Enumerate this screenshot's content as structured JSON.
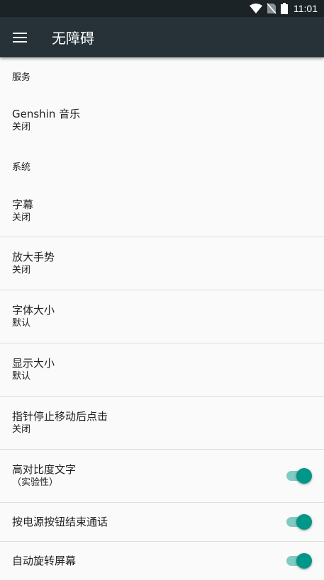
{
  "status_bar": {
    "time": "11:01",
    "icons": [
      "wifi-icon",
      "no-sim-icon",
      "battery-icon"
    ]
  },
  "toolbar": {
    "title": "无障碍",
    "menu_icon": "hamburger-menu-icon"
  },
  "sections": {
    "services_header": "服务",
    "system_header": "系统"
  },
  "items": {
    "genshin": {
      "title": "Genshin 音乐",
      "summary": "关闭"
    },
    "captions": {
      "title": "字幕",
      "summary": "关闭"
    },
    "magnification": {
      "title": "放大手势",
      "summary": "关闭"
    },
    "font_size": {
      "title": "字体大小",
      "summary": "默认"
    },
    "display_size": {
      "title": "显示大小",
      "summary": "默认"
    },
    "click_after_pointer_stops": {
      "title": "指针停止移动后点击",
      "summary": "关闭"
    },
    "high_contrast_text": {
      "title": "高对比度文字",
      "summary": "（实验性）",
      "checked": true
    },
    "power_button_ends_call": {
      "title": "按电源按钮结束通话",
      "checked": true
    },
    "auto_rotate": {
      "title": "自动旋转屏幕",
      "checked": true
    }
  },
  "colors": {
    "toolbar": "#263238",
    "status_bar": "#1c2326",
    "accent": "#009688",
    "accent_track": "#80cbc4",
    "background": "#fafafa"
  }
}
